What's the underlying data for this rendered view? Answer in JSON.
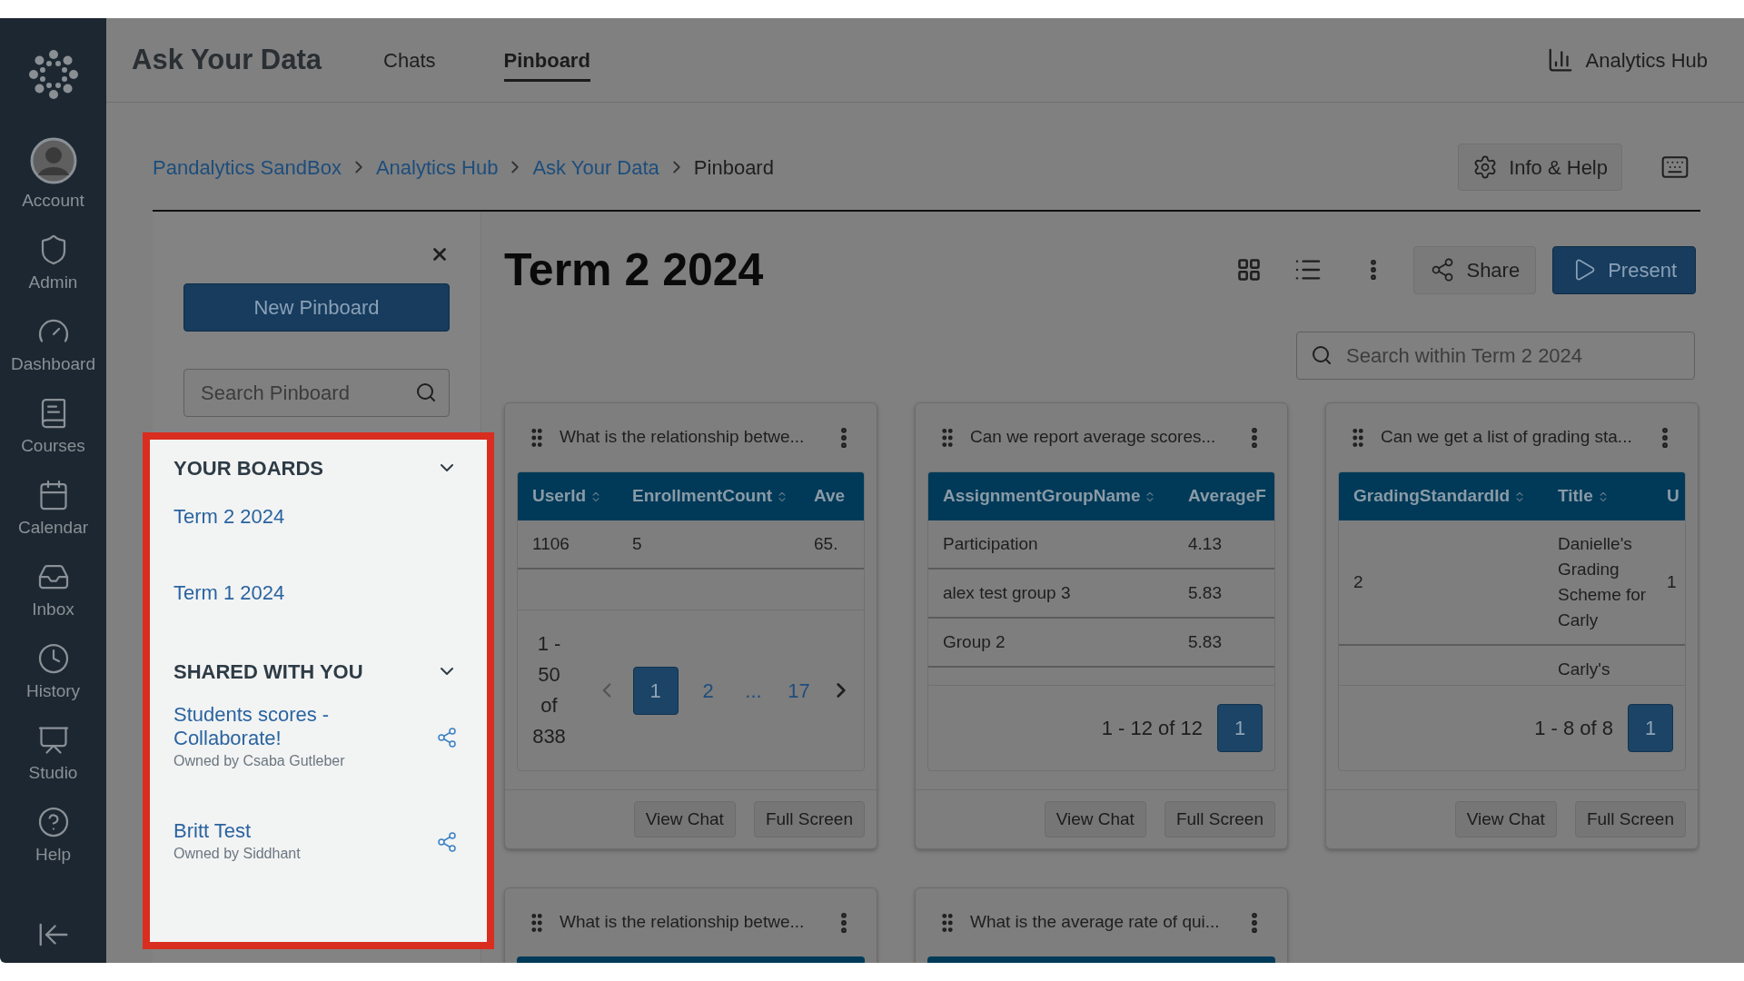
{
  "nav": {
    "items": [
      {
        "label": "Account"
      },
      {
        "label": "Admin"
      },
      {
        "label": "Dashboard"
      },
      {
        "label": "Courses"
      },
      {
        "label": "Calendar"
      },
      {
        "label": "Inbox"
      },
      {
        "label": "History"
      },
      {
        "label": "Studio"
      },
      {
        "label": "Help"
      }
    ]
  },
  "header": {
    "title": "Ask Your Data",
    "tabs": [
      {
        "label": "Chats",
        "selected": false
      },
      {
        "label": "Pinboard",
        "selected": true
      }
    ],
    "hub_link": "Analytics Hub"
  },
  "breadcrumb": {
    "links": [
      "Pandalytics SandBox",
      "Analytics Hub",
      "Ask Your Data"
    ],
    "current": "Pinboard"
  },
  "info_button": "Info & Help",
  "panel": {
    "new_button": "New Pinboard",
    "search": {
      "placeholder": "Search Pinboard"
    },
    "sections": [
      {
        "title": "YOUR BOARDS",
        "expanded": true,
        "boards": [
          {
            "name": "Term 2 2024",
            "shared": false
          },
          {
            "name": "Term 1 2024",
            "shared": false
          }
        ]
      },
      {
        "title": "SHARED WITH YOU",
        "expanded": true,
        "boards": [
          {
            "name": "Students scores - Collaborate!",
            "owner": "Owned by Csaba Gutleber",
            "shared": true
          },
          {
            "name": "Britt Test",
            "owner": "Owned by Siddhant",
            "shared": true
          }
        ]
      }
    ]
  },
  "board": {
    "title": "Term 2 2024",
    "share_button": "Share",
    "present_button": "Present",
    "search": {
      "placeholder": "Search within Term 2 2024"
    }
  },
  "cards": [
    {
      "title": "What is the relationship betwe...",
      "table": {
        "columns": [
          {
            "label": "UserId",
            "sortable": true
          },
          {
            "label": "EnrollmentCount",
            "sortable": true
          },
          {
            "label": "Ave"
          }
        ],
        "rows": [
          [
            "1106",
            "5",
            "65."
          ]
        ]
      },
      "pagination": {
        "range": "1 - 50 of 838",
        "arrows": true,
        "pages": [
          {
            "label": "1",
            "selected": true
          },
          {
            "label": "2",
            "selected": false
          },
          {
            "label": "...",
            "selected": false
          },
          {
            "label": "17",
            "selected": false
          }
        ]
      },
      "buttons": [
        "View Chat",
        "Full Screen"
      ]
    },
    {
      "title": "Can we report average scores...",
      "table": {
        "columns": [
          {
            "label": "AssignmentGroupName",
            "sortable": true
          },
          {
            "label": "AverageF"
          }
        ],
        "rows": [
          [
            "Participation",
            "4.13"
          ],
          [
            "alex test group 3",
            "5.83"
          ],
          [
            "Group 2",
            "5.83"
          ]
        ]
      },
      "pagination": {
        "range": "1 - 12 of 12",
        "arrows": false,
        "pages": [
          {
            "label": "1",
            "selected": true
          }
        ]
      },
      "buttons": [
        "View Chat",
        "Full Screen"
      ]
    },
    {
      "title": "Can we get a list of grading sta...",
      "table": {
        "columns": [
          {
            "label": "GradingStandardId",
            "sortable": true
          },
          {
            "label": "Title",
            "sortable": true
          },
          {
            "label": "U"
          }
        ],
        "rows": [
          [
            "2",
            "Danielle's Grading Scheme for Carly",
            "1"
          ],
          [
            null,
            "Carly's",
            null
          ]
        ]
      },
      "pagination": {
        "range": "1 - 8 of 8",
        "arrows": false,
        "pages": [
          {
            "label": "1",
            "selected": true
          }
        ]
      },
      "buttons": [
        "View Chat",
        "Full Screen"
      ]
    },
    {
      "title": "What is the relationship betwe..."
    },
    {
      "title": "What is the average rate of qui..."
    }
  ]
}
